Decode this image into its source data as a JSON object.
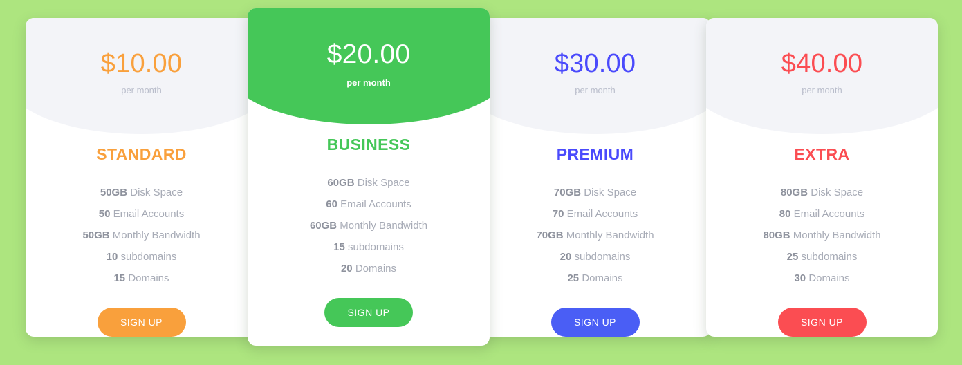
{
  "page": {
    "background_color": "#ade57f"
  },
  "plans": [
    {
      "id": "standard",
      "name": "STANDARD",
      "price": "$10.00",
      "period": "per month",
      "accent_color": "#f9a03c",
      "header_background": "#f3f4f8",
      "featured": false,
      "cta_label": "SIGN UP",
      "features": [
        {
          "amount": "50GB",
          "label": " Disk Space"
        },
        {
          "amount": "50",
          "label": " Email Accounts"
        },
        {
          "amount": "50GB",
          "label": " Monthly Bandwidth"
        },
        {
          "amount": "10",
          "label": " subdomains"
        },
        {
          "amount": "15",
          "label": " Domains"
        }
      ]
    },
    {
      "id": "business",
      "name": "BUSINESS",
      "price": "$20.00",
      "period": "per month",
      "accent_color": "#45c758",
      "header_background": "#45c758",
      "featured": true,
      "cta_label": "SIGN UP",
      "features": [
        {
          "amount": "60GB",
          "label": " Disk Space"
        },
        {
          "amount": "60",
          "label": " Email Accounts"
        },
        {
          "amount": "60GB",
          "label": " Monthly Bandwidth"
        },
        {
          "amount": "15",
          "label": " subdomains"
        },
        {
          "amount": "20",
          "label": " Domains"
        }
      ]
    },
    {
      "id": "premium",
      "name": "PREMIUM",
      "price": "$30.00",
      "period": "per month",
      "accent_color": "#4a4afc",
      "header_background": "#f3f4f8",
      "featured": false,
      "cta_label": "SIGN UP",
      "features": [
        {
          "amount": "70GB",
          "label": " Disk Space"
        },
        {
          "amount": "70",
          "label": " Email Accounts"
        },
        {
          "amount": "70GB",
          "label": " Monthly Bandwidth"
        },
        {
          "amount": "20",
          "label": " subdomains"
        },
        {
          "amount": "25",
          "label": " Domains"
        }
      ]
    },
    {
      "id": "extra",
      "name": "EXTRA",
      "price": "$40.00",
      "period": "per month",
      "accent_color": "#fb4d52",
      "header_background": "#f3f4f8",
      "featured": false,
      "cta_label": "SIGN UP",
      "features": [
        {
          "amount": "80GB",
          "label": " Disk Space"
        },
        {
          "amount": "80",
          "label": " Email Accounts"
        },
        {
          "amount": "80GB",
          "label": " Monthly Bandwidth"
        },
        {
          "amount": "25",
          "label": " subdomains"
        },
        {
          "amount": "30",
          "label": " Domains"
        }
      ]
    }
  ]
}
